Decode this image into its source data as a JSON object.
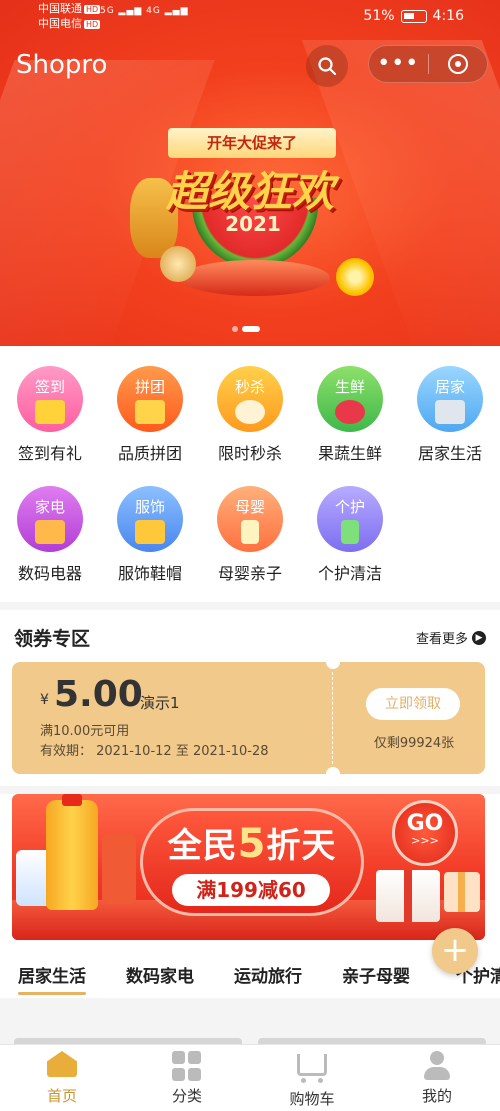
{
  "status_bar": {
    "carrier1": "中国联通",
    "carrier2": "中国电信",
    "hd": "HD",
    "battery": "51%",
    "time": "4:16"
  },
  "header": {
    "title": "Shopro",
    "search_icon": "search-icon",
    "more_icon": "more-dots-icon",
    "close_icon": "target-close-icon"
  },
  "banner": {
    "tag": "开年大促来了",
    "headline": "超级狂欢",
    "year": "2021",
    "indicator_count": 2,
    "active_index": 1
  },
  "categories": [
    {
      "tag": "签到",
      "label": "签到有礼",
      "color": "#ff6fa8"
    },
    {
      "tag": "拼团",
      "label": "品质拼团",
      "color": "#ff7a2e"
    },
    {
      "tag": "秒杀",
      "label": "限时秒杀",
      "color": "#ffb52e"
    },
    {
      "tag": "生鲜",
      "label": "果蔬生鲜",
      "color": "#5dcc5a"
    },
    {
      "tag": "居家",
      "label": "居家生活",
      "color": "#6ec0f5"
    },
    {
      "tag": "家电",
      "label": "数码电器",
      "color": "#c45ee0"
    },
    {
      "tag": "服饰",
      "label": "服饰鞋帽",
      "color": "#5e9ff0"
    },
    {
      "tag": "母婴",
      "label": "母婴亲子",
      "color": "#ff8a5a"
    },
    {
      "tag": "个护",
      "label": "个护清洁",
      "color": "#9a8cf0"
    }
  ],
  "coupon_section": {
    "title": "领券专区",
    "more": "查看更多",
    "coupon": {
      "currency": "¥",
      "amount": "5.00",
      "name": "演示1",
      "condition": "满10.00元可用",
      "validity": "有效期： 2021-10-12 至 2021-10-28",
      "claim": "立即领取",
      "remaining": "仅剩99924张"
    }
  },
  "promo_banner": {
    "title_pre": "全民",
    "title_num": "5",
    "title_post": "折天",
    "subtitle": "满199减60",
    "go": "GO",
    "go_arrows": ">>>"
  },
  "tabs": [
    {
      "label": "居家生活",
      "active": true
    },
    {
      "label": "数码家电",
      "active": false
    },
    {
      "label": "运动旅行",
      "active": false
    },
    {
      "label": "亲子母婴",
      "active": false
    },
    {
      "label": "个护清",
      "active": false
    }
  ],
  "bottom_nav": [
    {
      "label": "首页",
      "icon": "home-icon",
      "active": true
    },
    {
      "label": "分类",
      "icon": "category-icon",
      "active": false
    },
    {
      "label": "购物车",
      "icon": "cart-icon",
      "active": false
    },
    {
      "label": "我的",
      "icon": "profile-icon",
      "active": false
    }
  ],
  "colors": {
    "accent": "#c8962f",
    "coupon_bg": "#f0c98b",
    "banner_red": "#e5301a"
  }
}
